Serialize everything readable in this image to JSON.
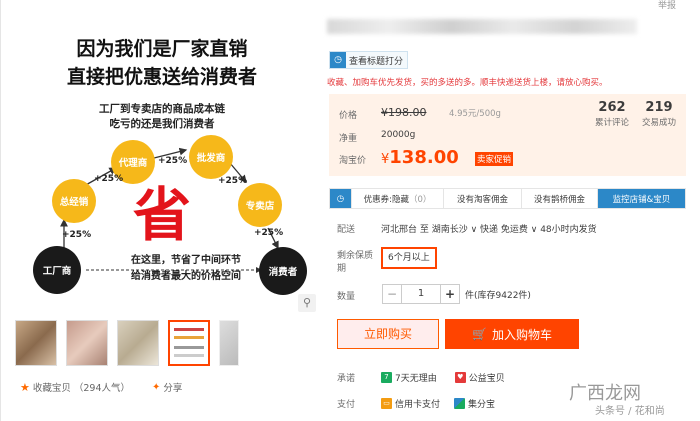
{
  "main_image": {
    "headline1": "因为我们是厂家直销",
    "headline2": "直接把优惠送给消费者",
    "sub1": "工厂到专卖店的商品成本链",
    "sub2": "吃亏的还是我们消费者",
    "nodes": {
      "factory": "工厂商",
      "distributor": "总经销",
      "agent": "代理商",
      "wholesaler": "批发商",
      "store": "专卖店",
      "consumer": "消费者"
    },
    "pct": "+25%",
    "big_char": "省",
    "note1": "在这里，节省了中间环节",
    "note2": "给消费者最大的价格空间"
  },
  "favorite": {
    "label": "收藏宝贝",
    "count": "（294人气）"
  },
  "share_label": "分享",
  "report": "举报",
  "rating_btn": "查看标题打分",
  "subtitle": "收藏、加购车优先发货，买的多送的多。顺丰快递送货上楼，请放心购买。",
  "price": {
    "label_price": "价格",
    "old_price": "¥198.00",
    "unit_price": "4.95元/500g",
    "label_weight": "净重",
    "weight": "20000g",
    "label_tb": "淘宝价",
    "currency": "¥",
    "tb_price": "138.00",
    "promo_tag": "卖家促销"
  },
  "stats": [
    {
      "num": "262",
      "label": "累计评论"
    },
    {
      "num": "219",
      "label": "交易成功"
    }
  ],
  "tabs": [
    {
      "label": "优惠券:隐藏",
      "count": "（0）"
    },
    {
      "label": "没有淘客佣金",
      "count": ""
    },
    {
      "label": "没有鹊桥佣金",
      "count": ""
    },
    {
      "label": "监控店铺&宝贝",
      "count": ""
    }
  ],
  "delivery": {
    "label": "配送",
    "text": "河北邢台 至 湖南长沙 ∨ 快递 免运费 ∨ 48小时内发货"
  },
  "shelf": {
    "label": "剩余保质期",
    "option": "6个月以上"
  },
  "quantity": {
    "label": "数量",
    "value": "1",
    "stock": "件(库存9422件)"
  },
  "buy_btn": "立即购买",
  "cart_btn": "加入购物车",
  "promise": {
    "label": "承诺",
    "items": [
      "7天无理由",
      "公益宝贝"
    ]
  },
  "payment": {
    "label": "支付",
    "items": [
      "信用卡支付",
      "集分宝"
    ]
  },
  "watermark": {
    "line1": "广西龙网",
    "line2": "头条号 / 花和尚"
  }
}
